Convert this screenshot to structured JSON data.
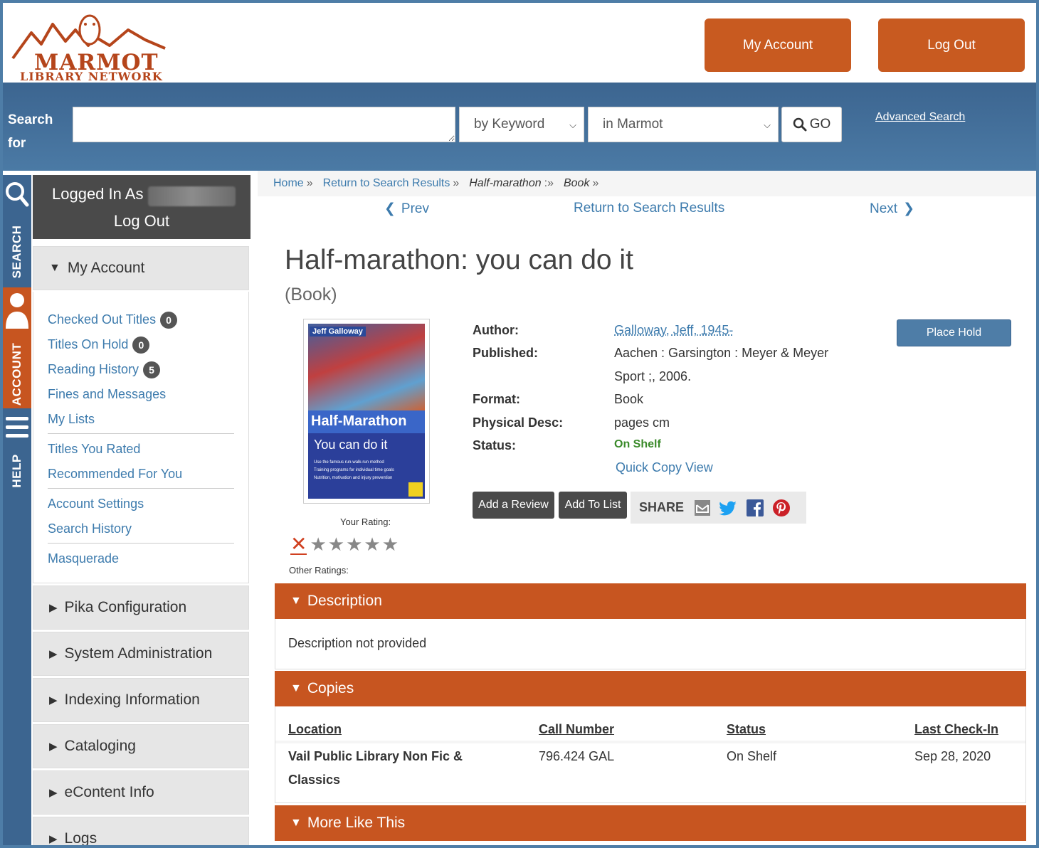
{
  "header": {
    "logo_text_line1": "MARMOT",
    "logo_text_line2": "LIBRARY NETWORK",
    "my_account": "My Account",
    "log_out": "Log Out"
  },
  "search": {
    "label": "Search for",
    "input_value": "",
    "type_select": "by Keyword",
    "scope_select": "in Marmot",
    "go": "GO",
    "advanced": "Advanced Search"
  },
  "vtabs": {
    "search": "SEARCH",
    "account": "ACCOUNT",
    "help": "HELP"
  },
  "sidebar": {
    "logged_in_as": "Logged In As",
    "log_out": "Log Out",
    "my_account": "My Account",
    "links": [
      {
        "label": "Checked Out Titles",
        "badge": "0"
      },
      {
        "label": "Titles On Hold",
        "badge": "0"
      },
      {
        "label": "Reading History",
        "badge": "5"
      },
      {
        "label": "Fines and Messages"
      },
      {
        "label": "My Lists"
      },
      {
        "label": "Titles You Rated"
      },
      {
        "label": "Recommended For You"
      },
      {
        "label": "Account Settings"
      },
      {
        "label": "Search History"
      },
      {
        "label": "Masquerade"
      }
    ],
    "sections": [
      "Pika Configuration",
      "System Administration",
      "Indexing Information",
      "Cataloging",
      "eContent Info",
      "Logs"
    ]
  },
  "breadcrumb": {
    "home": "Home",
    "return": "Return to Search Results",
    "current": "Half-marathon",
    "format": "Book"
  },
  "nav": {
    "prev": "Prev",
    "return": "Return to Search Results",
    "next": "Next"
  },
  "record": {
    "title": "Half-marathon: you can do it",
    "format_paren": "(Book)",
    "cover_author": "Jeff Galloway",
    "cover_title": "Half-Marathon",
    "cover_subtitle": "You can do it",
    "cover_bullets": [
      "Use the famous run-walk-run method",
      "Training programs for individual time goals",
      "Nutrition, motivation and injury prevention"
    ],
    "your_rating": "Your Rating:",
    "other_ratings": "Other Ratings:",
    "user_rating": 0,
    "author_label": "Author:",
    "author": "Galloway, Jeff, 1945-",
    "published_label": "Published:",
    "published_line1": "Aachen : Garsington : Meyer & Meyer",
    "published_line2": "Sport ;, 2006.",
    "format_label": "Format:",
    "format": "Book",
    "phys_label": "Physical Desc:",
    "phys": "pages cm",
    "status_label": "Status:",
    "status": "On Shelf",
    "quick_copy": "Quick Copy View",
    "place_hold": "Place Hold",
    "add_review": "Add a Review",
    "add_list": "Add To List",
    "share": "SHARE"
  },
  "panels": {
    "description_title": "Description",
    "description_body": "Description not provided",
    "copies_title": "Copies",
    "copies_headers": [
      "Location",
      "Call Number",
      "Status",
      "Last Check-In"
    ],
    "copies_row": {
      "location": "Vail Public Library Non Fic & Classics",
      "call_number": "796.424 GAL",
      "status": "On Shelf",
      "last_checkin": "Sep 28, 2020"
    },
    "more_title": "More Like This"
  },
  "colors": {
    "brand_orange": "#c85a20",
    "brand_blue": "#4e7da7",
    "status_green": "#3a8a2a",
    "link_blue": "#3d7bad"
  }
}
